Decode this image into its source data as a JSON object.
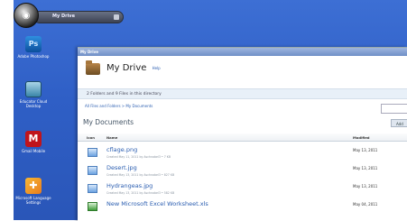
{
  "taskbar": {
    "title": "My Drive"
  },
  "desktop_icons": [
    {
      "label": "Adobe Photoshop",
      "icon": "photoshop-icon"
    },
    {
      "label": "Educator Cloud Desktop",
      "icon": "drive-icon"
    },
    {
      "label": "Gmail Mobile",
      "icon": "m-icon"
    },
    {
      "label": "Microsoft Language Settings",
      "icon": "puzzle-icon"
    }
  ],
  "window": {
    "title": "My Drive",
    "heading": "My Drive",
    "help": "Help",
    "info": "2 Folders and 9 Files in this directory",
    "breadcrumb": "All Files and Folders > My Documents",
    "section_title": "My Documents",
    "add_label": "Add",
    "columns": {
      "icon": "Icon",
      "name": "Name",
      "modified": "Modified"
    },
    "files": [
      {
        "name": "cflage.png",
        "meta": "Created May 11, 2011 by Aschnabel3 • 7 KB",
        "modified": "May 13, 2011"
      },
      {
        "name": "Desert.jpg",
        "meta": "Created May 13, 2011 by Aschnabel3 • 827 KB",
        "modified": "May 13, 2011"
      },
      {
        "name": "Hydrangeas.jpg",
        "meta": "Created May 13, 2011 by Aschnabel3 • 582 KB",
        "modified": "May 13, 2011"
      },
      {
        "name": "New Microsoft Excel Worksheet.xls",
        "meta": "",
        "modified": "May 04, 2011"
      }
    ]
  }
}
